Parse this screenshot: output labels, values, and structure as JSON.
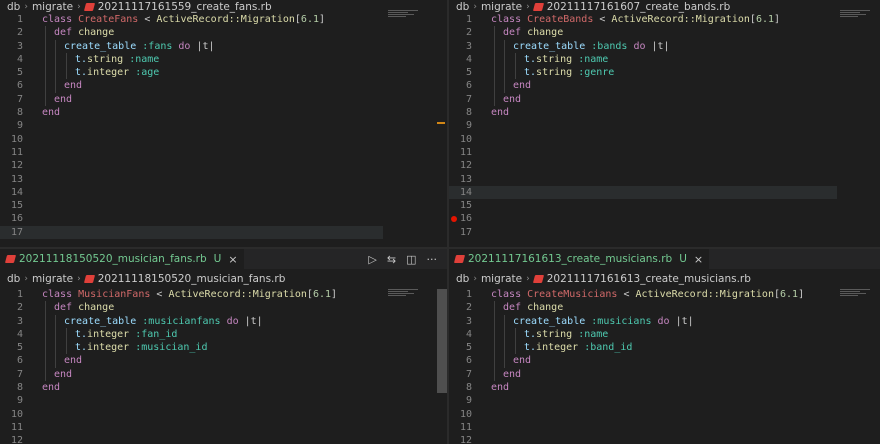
{
  "panes": {
    "tl": {
      "breadcrumb": [
        "db",
        "migrate",
        "20211117161559_create_fans.rb"
      ],
      "lines": [
        "1",
        "2",
        "3",
        "4",
        "5",
        "6",
        "7",
        "8",
        "9",
        "10",
        "11",
        "12",
        "13",
        "14",
        "15",
        "16",
        "17"
      ],
      "code": {
        "l1": [
          "class ",
          "CreateFans",
          " < ",
          "ActiveRecord::Migration",
          "[",
          "6.1",
          "]"
        ],
        "l2": [
          "def ",
          "change"
        ],
        "l3": [
          "create_table ",
          ":fans ",
          "do ",
          "|t|"
        ],
        "l4": [
          "t.",
          "string ",
          ":name"
        ],
        "l5": [
          "t.",
          "integer ",
          ":age"
        ],
        "l6": [
          "end"
        ],
        "l7": [
          "end"
        ],
        "l8": [
          "end"
        ]
      }
    },
    "tr": {
      "breadcrumb": [
        "db",
        "migrate",
        "20211117161607_create_bands.rb"
      ],
      "lines": [
        "1",
        "2",
        "3",
        "4",
        "5",
        "6",
        "7",
        "8",
        "9",
        "10",
        "11",
        "12",
        "13",
        "14",
        "15",
        "16",
        "17"
      ],
      "code": {
        "l1": [
          "class ",
          "CreateBands",
          " < ",
          "ActiveRecord::Migration",
          "[",
          "6.1",
          "]"
        ],
        "l2": [
          "def ",
          "change"
        ],
        "l3": [
          "create_table ",
          ":bands ",
          "do ",
          "|t|"
        ],
        "l4": [
          "t.",
          "string ",
          ":name"
        ],
        "l5": [
          "t.",
          "string ",
          ":genre"
        ],
        "l6": [
          "end"
        ],
        "l7": [
          "end"
        ],
        "l8": [
          "end"
        ]
      }
    },
    "bl": {
      "tab": {
        "name": "20211118150520_musician_fans.rb",
        "status": "U",
        "close": "×"
      },
      "breadcrumb": [
        "db",
        "migrate",
        "20211118150520_musician_fans.rb"
      ],
      "lines": [
        "1",
        "2",
        "3",
        "4",
        "5",
        "6",
        "7",
        "8",
        "9",
        "10",
        "11",
        "12"
      ],
      "code": {
        "l1": [
          "class ",
          "MusicianFans",
          " < ",
          "ActiveRecord::Migration",
          "[",
          "6.1",
          "]"
        ],
        "l2": [
          "def ",
          "change"
        ],
        "l3": [
          "create_table ",
          ":musicianfans ",
          "do ",
          "|t|"
        ],
        "l4": [
          "t.",
          "integer ",
          ":fan_id"
        ],
        "l5": [
          "t.",
          "integer ",
          ":musician_id"
        ],
        "l6": [
          "end"
        ],
        "l7": [
          "end"
        ],
        "l8": [
          "end"
        ]
      }
    },
    "br": {
      "tab": {
        "name": "20211117161613_create_musicians.rb",
        "status": "U",
        "close": "×"
      },
      "breadcrumb": [
        "db",
        "migrate",
        "20211117161613_create_musicians.rb"
      ],
      "lines": [
        "1",
        "2",
        "3",
        "4",
        "5",
        "6",
        "7",
        "8",
        "9",
        "10",
        "11",
        "12"
      ],
      "code": {
        "l1": [
          "class ",
          "CreateMusicians",
          " < ",
          "ActiveRecord::Migration",
          "[",
          "6.1",
          "]"
        ],
        "l2": [
          "def ",
          "change"
        ],
        "l3": [
          "create_table ",
          ":musicians ",
          "do ",
          "|t|"
        ],
        "l4": [
          "t.",
          "string ",
          ":name"
        ],
        "l5": [
          "t.",
          "integer ",
          ":band_id"
        ],
        "l6": [
          "end"
        ],
        "l7": [
          "end"
        ],
        "l8": [
          "end"
        ]
      }
    }
  },
  "tab_actions": {
    "run": "▷",
    "compare": "⇆",
    "split": "◫",
    "more": "···"
  },
  "sep": "›"
}
